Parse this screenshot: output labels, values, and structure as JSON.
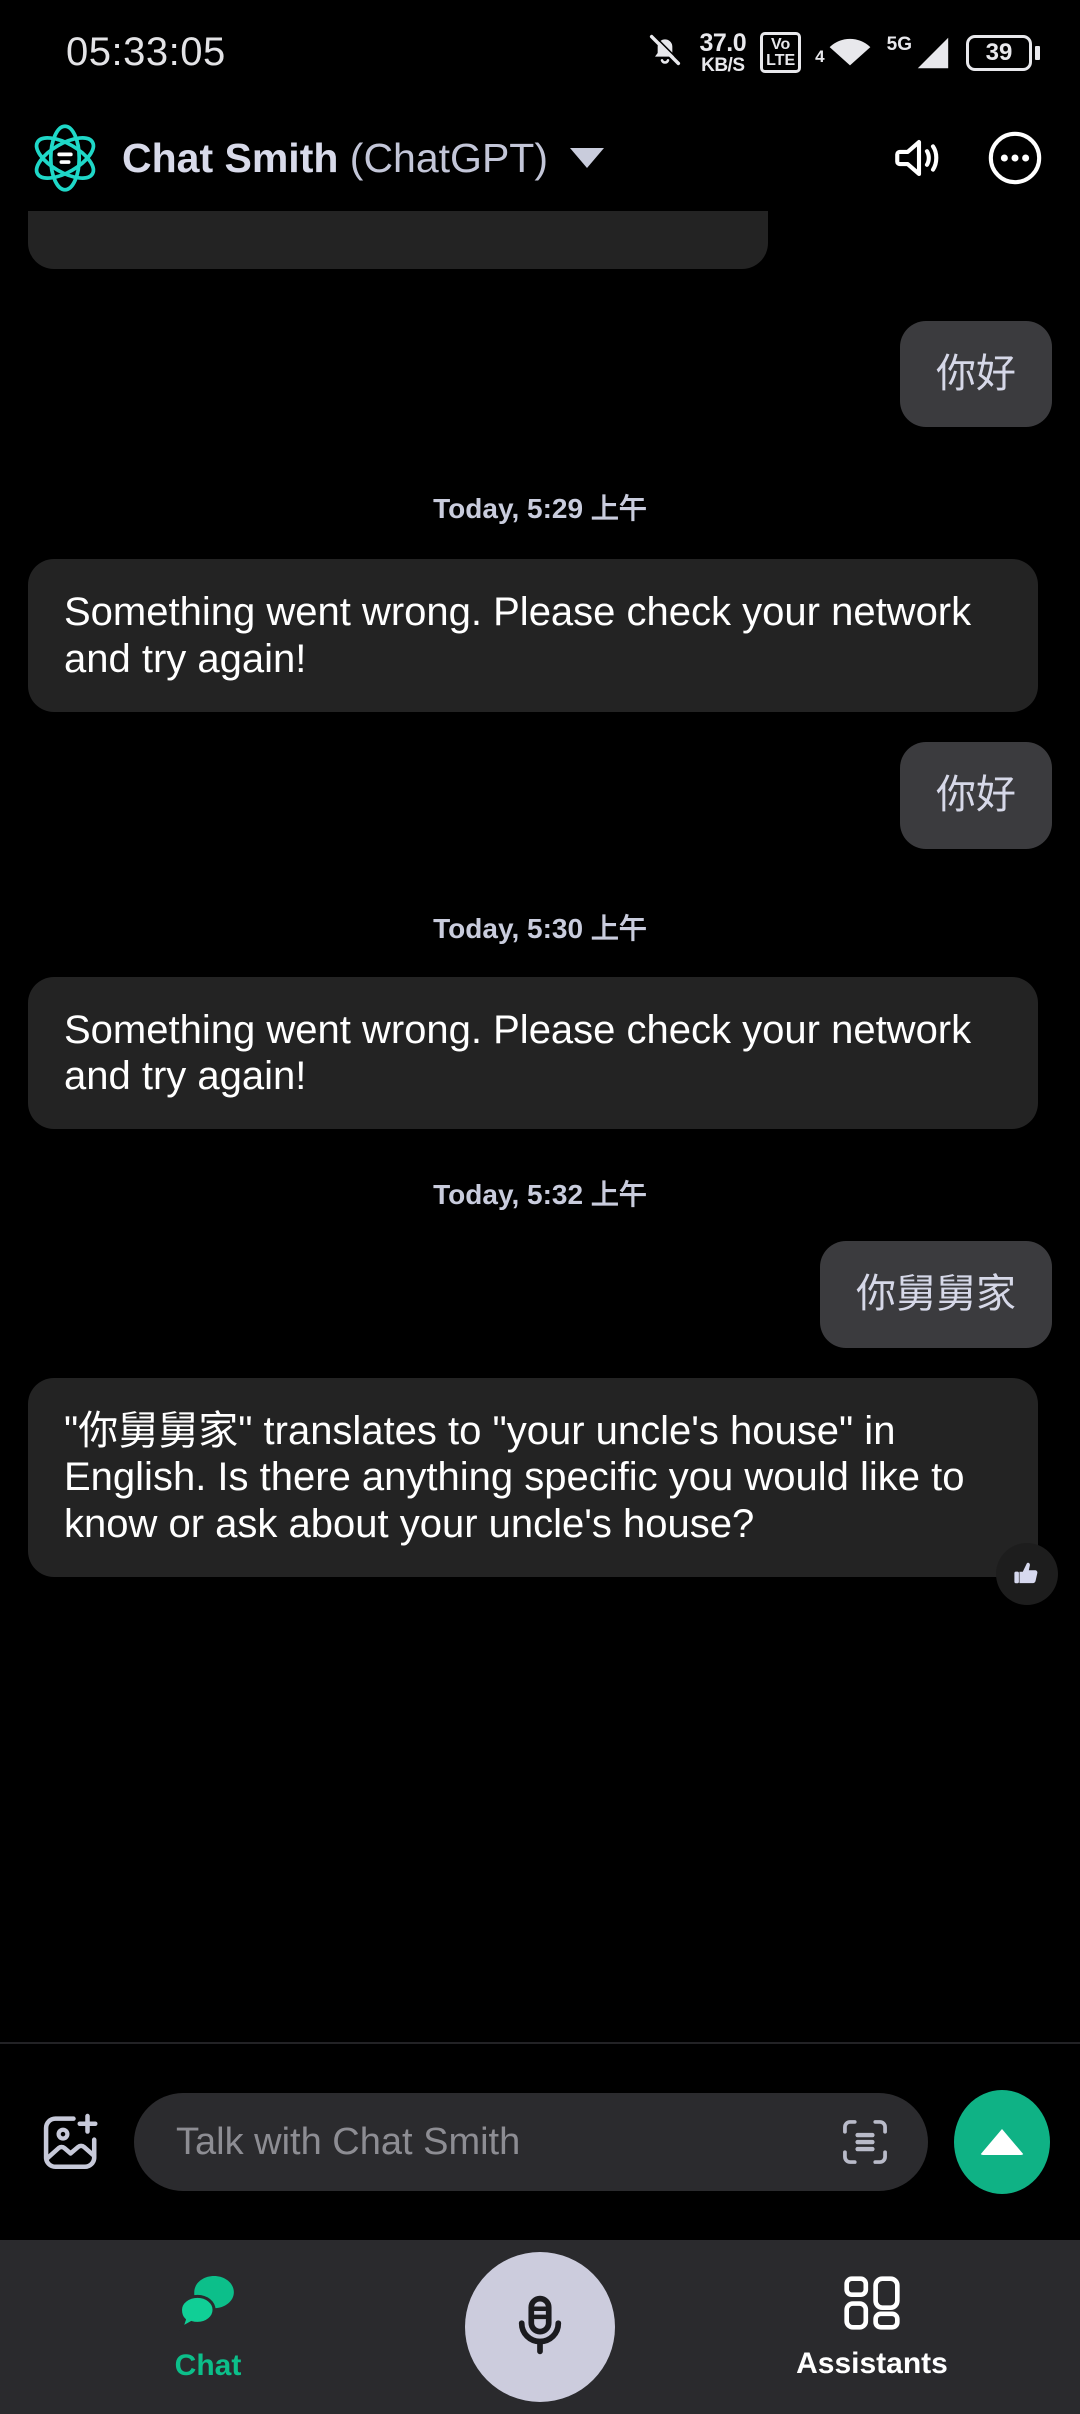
{
  "status_bar": {
    "clock": "05:33:05",
    "notification_icon": "bell-muted-icon",
    "net_speed_value": "37.0",
    "net_speed_unit": "KB/S",
    "volte_top": "Vo",
    "volte_bottom": "LTE",
    "wifi_icon": "wifi-icon",
    "wifi_badge": "4",
    "signal_label": "5G",
    "battery_level": "39"
  },
  "header": {
    "logo_icon": "atom-logo-icon",
    "title_bold": "Chat Smith",
    "title_normal": " (ChatGPT)",
    "dropdown_icon": "chevron-down-icon",
    "speaker_icon": "speaker-icon",
    "more_icon": "more-options-icon",
    "accent_color": "#1fd8c8"
  },
  "conversation": {
    "messages": [
      {
        "type": "bot",
        "text": "",
        "clipped": true
      },
      {
        "type": "user",
        "text": "你好"
      },
      {
        "type": "timestamp",
        "text": "Today, 5:29 上午"
      },
      {
        "type": "bot",
        "text": "Something went wrong. Please check your network and try again!"
      },
      {
        "type": "user",
        "text": "你好"
      },
      {
        "type": "timestamp",
        "text": "Today, 5:30 上午"
      },
      {
        "type": "bot",
        "text": "Something went wrong. Please check your network and try again!"
      },
      {
        "type": "timestamp",
        "text": "Today, 5:32 上午"
      },
      {
        "type": "user",
        "text": "你舅舅家"
      },
      {
        "type": "bot",
        "text": "\"你舅舅家\" translates to \"your uncle's house\" in English. Is there anything specific you would like to know or ask about your uncle's house?",
        "reaction": "thumbs-up-icon"
      }
    ]
  },
  "composer": {
    "attach_icon": "add-image-icon",
    "placeholder": "Talk with Chat Smith",
    "scan_icon": "scan-text-icon",
    "send_icon": "send-arrow-icon",
    "send_color": "#0fb285"
  },
  "bottom_nav": {
    "chat_label": "Chat",
    "chat_icon": "chat-bubbles-icon",
    "mic_icon": "microphone-icon",
    "assistants_label": "Assistants",
    "assistants_icon": "grid-apps-icon",
    "active_color": "#0cbf8a"
  }
}
